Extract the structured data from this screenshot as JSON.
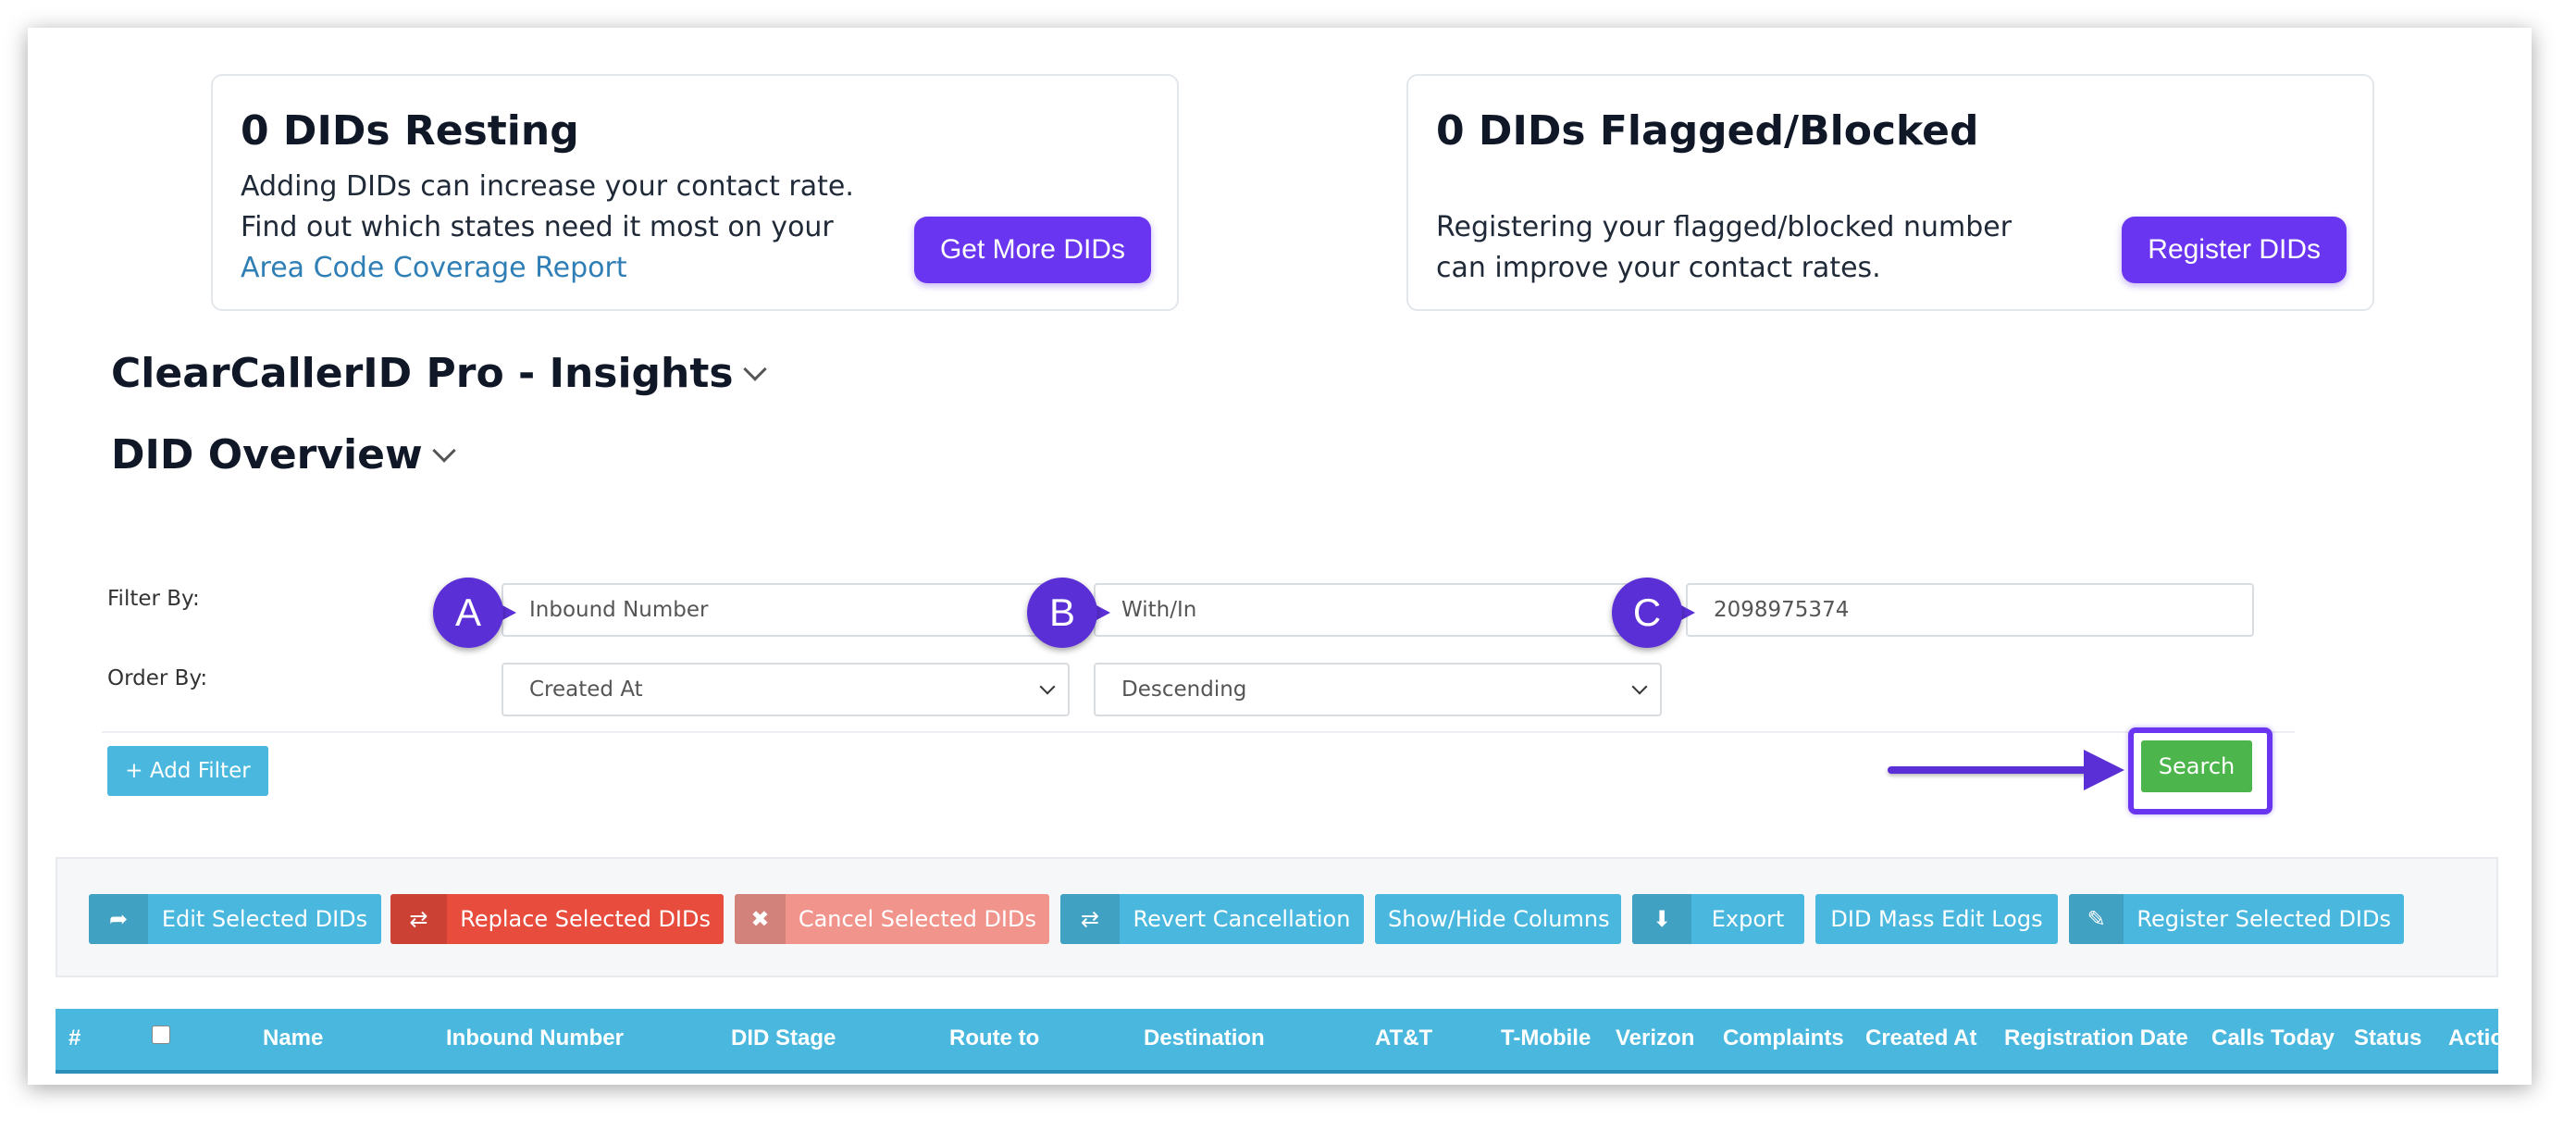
{
  "cards": {
    "resting": {
      "title": "0 DIDs Resting",
      "line1": "Adding DIDs can increase your contact rate.",
      "line2": "Find out which states need it most on your",
      "link": "Area Code Coverage Report",
      "button": "Get More DIDs"
    },
    "flagged": {
      "title": "0 DIDs Flagged/Blocked",
      "line1": "Registering your flagged/blocked number",
      "line2": "can improve your contact rates.",
      "button": "Register DIDs"
    }
  },
  "sections": {
    "insights": "ClearCallerID Pro - Insights",
    "overview": "DID Overview"
  },
  "filters": {
    "filter_label": "Filter By:",
    "order_label": "Order By:",
    "field": "Inbound Number",
    "operator": "With/In",
    "value": "2098975374",
    "order_field": "Created At",
    "order_direction": "Descending",
    "add_filter": "+ Add Filter",
    "search": "Search"
  },
  "markers": {
    "a": "A",
    "b": "B",
    "c": "C"
  },
  "toolbar": {
    "edit": "Edit Selected DIDs",
    "replace": "Replace Selected DIDs",
    "cancel": "Cancel Selected DIDs",
    "revert": "Revert Cancellation",
    "columns": "Show/Hide Columns",
    "export": "Export",
    "logs": "DID Mass Edit Logs",
    "register": "Register Selected DIDs"
  },
  "table": {
    "columns": [
      "#",
      "Name",
      "Inbound Number",
      "DID Stage",
      "Route to",
      "Destination",
      "AT&T",
      "T-Mobile",
      "Verizon",
      "Complaints",
      "Created At",
      "Registration Date",
      "Calls Today",
      "Status",
      "Action"
    ]
  },
  "colors": {
    "accent_purple": "#6a35f0",
    "marker_purple": "#5b2fd6",
    "info_blue": "#4ab8de",
    "danger_red": "#e74c3c",
    "success_green": "#4cb64c"
  },
  "icons": {
    "edit": "share-arrow-icon",
    "replace": "retweet-icon",
    "cancel": "times-icon",
    "revert": "retweet-icon",
    "export": "download-icon",
    "register": "edit-square-icon"
  }
}
